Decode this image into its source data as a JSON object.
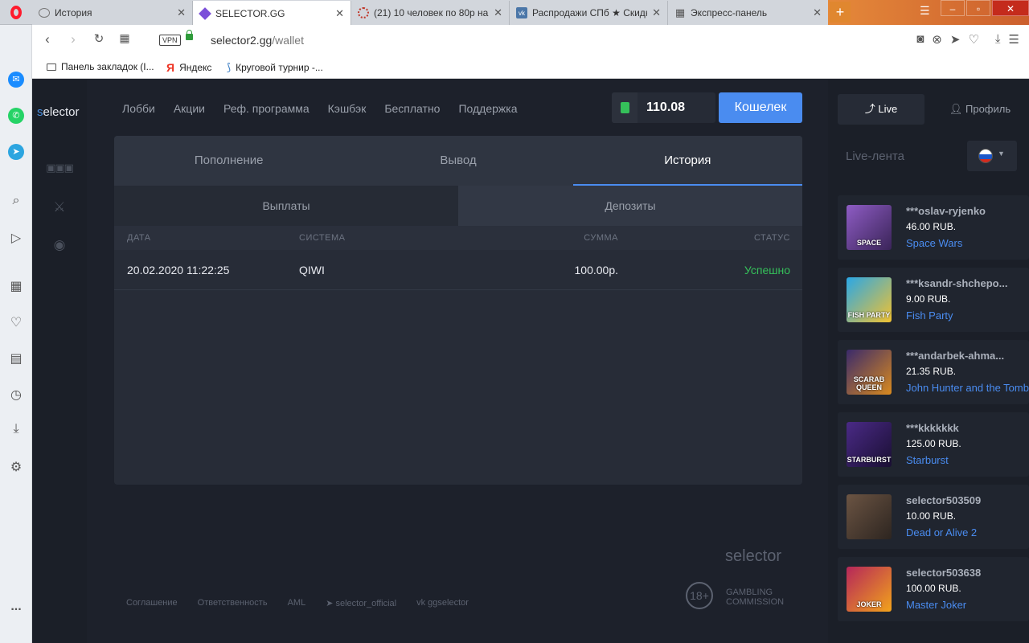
{
  "browser": {
    "tabs": [
      {
        "title": "История",
        "active": false
      },
      {
        "title": "SELECTOR.GG",
        "active": true
      },
      {
        "title": "(21) 10 человек по 80р на",
        "active": false
      },
      {
        "title": "Распродажи СПб ★ Скидк",
        "active": false
      },
      {
        "title": "Экспресс-панель",
        "active": false
      }
    ],
    "new_tab": "+",
    "vpn": "VPN",
    "url_host": "selector2.gg",
    "url_path": "/wallet",
    "bookmarks": [
      {
        "label": "Панель закладок (I..."
      },
      {
        "label": "Яндекс"
      },
      {
        "label": "Круговой турнир -..."
      }
    ],
    "sidebar_icons": [
      "messenger-icon",
      "whatsapp-icon",
      "telegram-icon",
      "search-icon",
      "send-icon",
      "grid-icon",
      "heart-icon",
      "news-icon",
      "history-icon",
      "download-icon",
      "settings-icon",
      "more-icon"
    ],
    "more": "..."
  },
  "site": {
    "logo_s": "s",
    "logo_rest": "elector",
    "nav": [
      "Лобби",
      "Акции",
      "Реф. программа",
      "Кэшбэк",
      "Бесплатно",
      "Поддержка"
    ],
    "balance": "110.08",
    "wallet_button": "Кошелек",
    "wallet_tabs": [
      {
        "label": "Пополнение",
        "active": false
      },
      {
        "label": "Вывод",
        "active": false
      },
      {
        "label": "История",
        "active": true
      }
    ],
    "history_subtabs": [
      {
        "label": "Выплаты",
        "active": false
      },
      {
        "label": "Депозиты",
        "active": true
      }
    ],
    "table": {
      "headers": [
        "ДАТА",
        "СИСТЕМА",
        "СУММА",
        "СТАТУС"
      ],
      "rows": [
        {
          "date": "20.02.2020 11:22:25",
          "system": "QIWI",
          "amount": "100.00р.",
          "status": "Успешно"
        }
      ]
    },
    "footer": {
      "brand_s": "s",
      "brand_rest": "elector",
      "links": [
        "Соглашение",
        "Ответственность",
        "AML",
        "selector_official",
        "ggselector"
      ],
      "age": "18+",
      "commission_1": "GAMBLING",
      "commission_2": "COMMISSION"
    },
    "right": {
      "live_tab": "Live",
      "profile_tab": "Профиль",
      "feed_title": "Live-лента",
      "feed": [
        {
          "user": "***oslav-ryjenko",
          "amount": "46.00 RUB.",
          "game": "Space Wars",
          "thumb_text": "SPACE",
          "color": "#6b3f8f"
        },
        {
          "user": "***ksandr-shchepo...",
          "amount": "9.00 RUB.",
          "game": "Fish Party",
          "thumb_text": "FISH PARTY",
          "color": "#1d8bd1"
        },
        {
          "user": "***andarbek-ahma...",
          "amount": "21.35 RUB.",
          "game": "John Hunter and the Tomb",
          "thumb_text": "SCARAB QUEEN",
          "color": "#3a2a6b"
        },
        {
          "user": "***kkkkkkk",
          "amount": "125.00 RUB.",
          "game": "Starburst",
          "thumb_text": "STARBURST",
          "color": "#3b1f66"
        },
        {
          "user": "selector503509",
          "amount": "10.00 RUB.",
          "game": "Dead or Alive 2",
          "thumb_text": "",
          "color": "#4a3b33"
        },
        {
          "user": "selector503638",
          "amount": "100.00 RUB.",
          "game": "Master Joker",
          "thumb_text": "JOKER",
          "color": "#7a1a3f"
        }
      ]
    }
  }
}
